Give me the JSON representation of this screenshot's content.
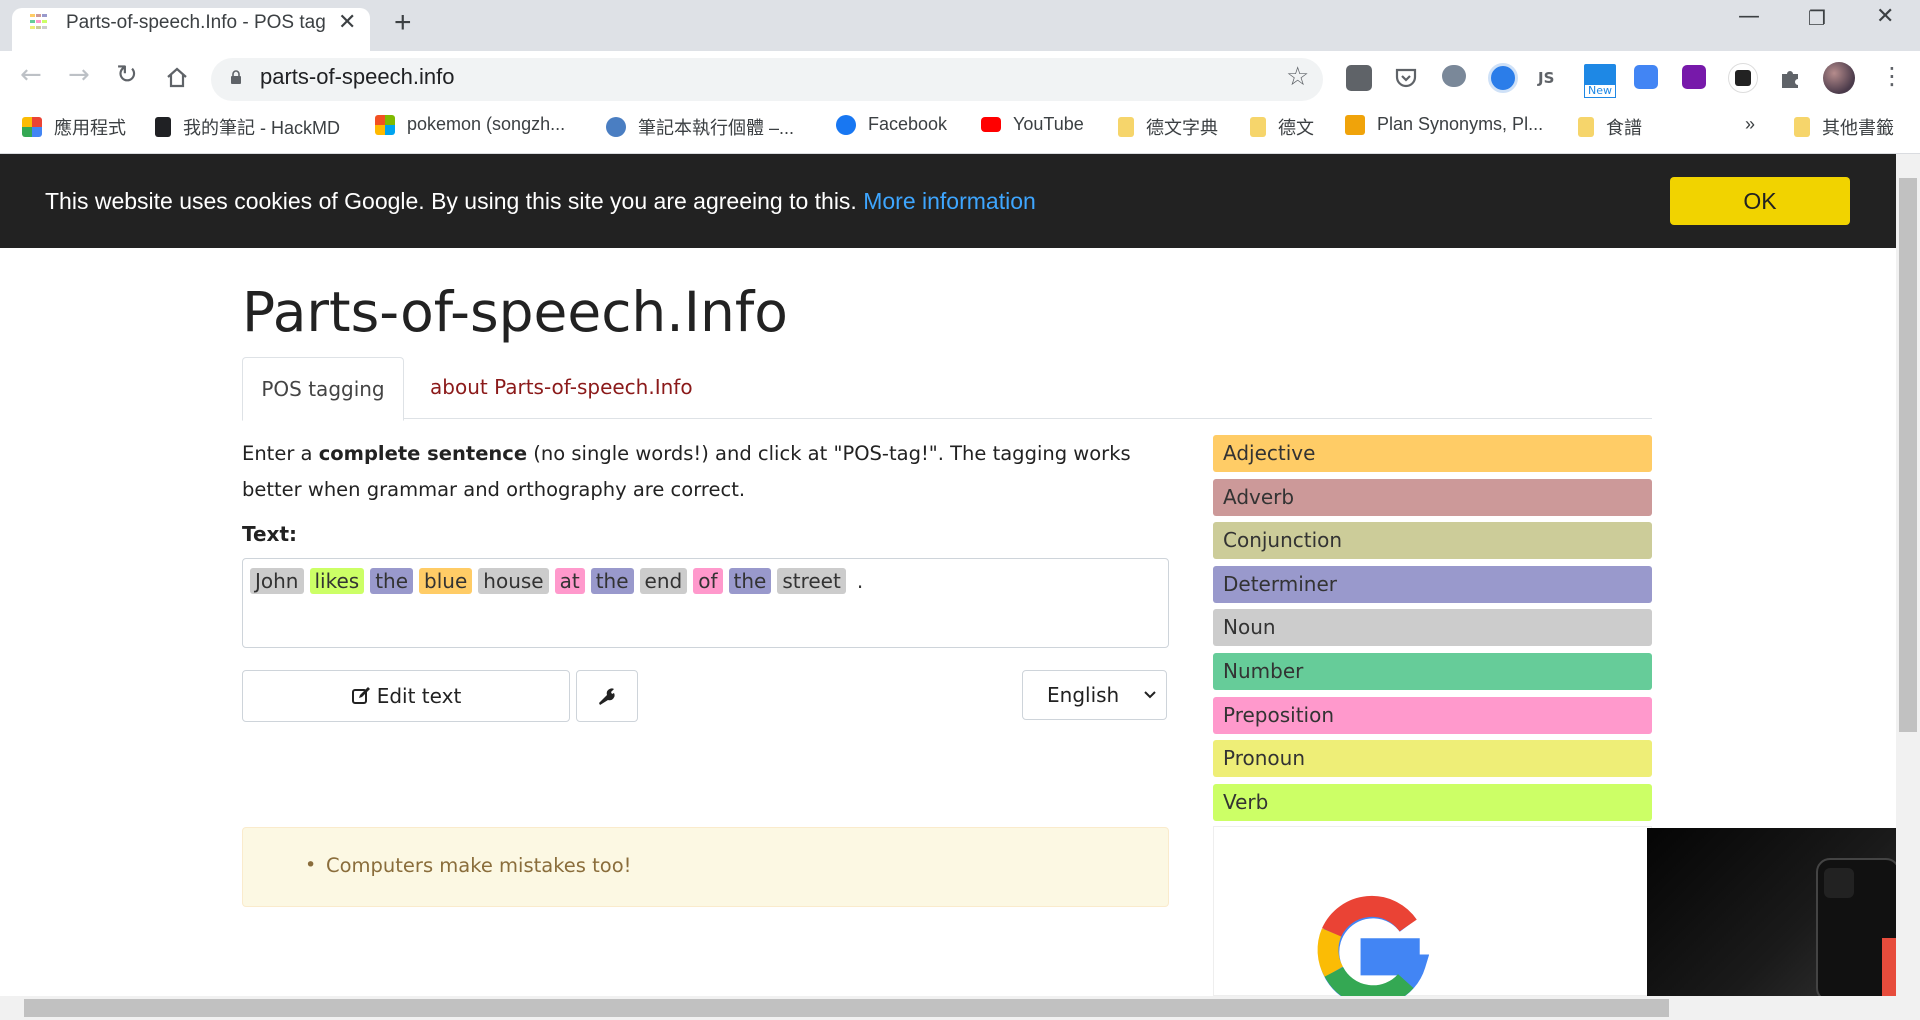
{
  "browser": {
    "tab_title": "Parts-of-speech.Info - POS tag",
    "url": "parts-of-speech.info",
    "new_badge": "New",
    "bookmarks": [
      {
        "label": "應用程式",
        "icon": "apps-grid-icon"
      },
      {
        "label": "我的筆記 - HackMD",
        "icon": "document-icon"
      },
      {
        "label": "pokemon (songzh...",
        "icon": "microsoft-icon"
      },
      {
        "label": "筆記本執行個體 –...",
        "icon": "brain-icon"
      },
      {
        "label": "Facebook",
        "icon": "facebook-icon"
      },
      {
        "label": "YouTube",
        "icon": "youtube-icon"
      },
      {
        "label": "德文字典",
        "icon": "folder-icon"
      },
      {
        "label": "德文",
        "icon": "folder-icon"
      },
      {
        "label": "Plan Synonyms, Pl...",
        "icon": "thesaurus-icon"
      },
      {
        "label": "食譜",
        "icon": "folder-icon"
      },
      {
        "label": "»",
        "icon": "overflow-icon"
      },
      {
        "label": "其他書籤",
        "icon": "folder-icon"
      }
    ]
  },
  "cookie": {
    "text": "This website uses cookies of Google. By using this site you are agreeing to this.",
    "link": "More information",
    "ok": "OK"
  },
  "page": {
    "title": "Parts-of-speech.Info",
    "tabs": [
      {
        "label": "POS tagging",
        "active": true
      },
      {
        "label": "about Parts-of-speech.Info",
        "active": false
      }
    ],
    "intro_pre": "Enter a ",
    "intro_bold": "complete sentence",
    "intro_post": " (no single words!) and click at \"POS-tag!\". The tagging works better when grammar and orthography are correct.",
    "text_label": "Text:",
    "tagged_words": [
      {
        "word": "John",
        "color": "#cccccc"
      },
      {
        "word": "likes",
        "color": "#ccff66"
      },
      {
        "word": "the",
        "color": "#9999cc"
      },
      {
        "word": "blue",
        "color": "#ffcc66"
      },
      {
        "word": "house",
        "color": "#cccccc"
      },
      {
        "word": "at",
        "color": "#ff99cc"
      },
      {
        "word": "the",
        "color": "#9999cc"
      },
      {
        "word": "end",
        "color": "#cccccc"
      },
      {
        "word": "of",
        "color": "#ff99cc"
      },
      {
        "word": "the",
        "color": "#9999cc"
      },
      {
        "word": "street",
        "color": "#cccccc"
      },
      {
        "word": ".",
        "color": "transparent"
      }
    ],
    "edit_button": "Edit text",
    "language": "English",
    "info": "Computers make mistakes too!",
    "legend": [
      {
        "label": "Adjective",
        "color": "#ffcc66"
      },
      {
        "label": "Adverb",
        "color": "#cc9999"
      },
      {
        "label": "Conjunction",
        "color": "#cccc99"
      },
      {
        "label": "Determiner",
        "color": "#9999cc"
      },
      {
        "label": "Noun",
        "color": "#cccccc"
      },
      {
        "label": "Number",
        "color": "#66cc99"
      },
      {
        "label": "Preposition",
        "color": "#ff99cc"
      },
      {
        "label": "Pronoun",
        "color": "#eeee77"
      },
      {
        "label": "Verb",
        "color": "#ccff66"
      }
    ]
  }
}
